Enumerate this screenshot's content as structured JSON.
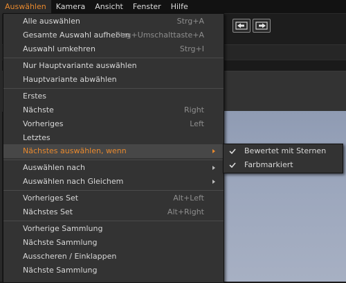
{
  "menubar": {
    "items": [
      "Auswählen",
      "Kamera",
      "Ansicht",
      "Fenster",
      "Hilfe"
    ]
  },
  "toolbar": {
    "icons": [
      "prev-image-icon",
      "next-image-icon"
    ]
  },
  "menu": {
    "items": [
      {
        "label": "Alle auswählen",
        "shortcut": "Strg+A"
      },
      {
        "label": "Gesamte Auswahl aufheben",
        "shortcut": "Strg+Umschalttaste+A"
      },
      {
        "label": "Auswahl umkehren",
        "shortcut": "Strg+I"
      },
      {
        "label": "Nur Hauptvariante auswählen",
        "shortcut": ""
      },
      {
        "label": "Hauptvariante abwählen",
        "shortcut": ""
      },
      {
        "label": "Erstes",
        "shortcut": ""
      },
      {
        "label": "Nächste",
        "shortcut": "Right"
      },
      {
        "label": "Vorheriges",
        "shortcut": "Left"
      },
      {
        "label": "Letztes",
        "shortcut": ""
      },
      {
        "label": "Nächstes auswählen, wenn",
        "shortcut": "",
        "submenu": true,
        "highlighted": true
      },
      {
        "label": "Auswählen nach",
        "shortcut": "",
        "submenu": true
      },
      {
        "label": "Auswählen nach Gleichem",
        "shortcut": "",
        "submenu": true
      },
      {
        "label": "Vorheriges Set",
        "shortcut": "Alt+Left"
      },
      {
        "label": "Nächstes Set",
        "shortcut": "Alt+Right"
      },
      {
        "label": "Vorherige Sammlung",
        "shortcut": ""
      },
      {
        "label": "Nächste Sammlung",
        "shortcut": ""
      },
      {
        "label": "Ausscheren / Einklappen",
        "shortcut": ""
      },
      {
        "label": "Nächste Sammlung",
        "shortcut": ""
      }
    ]
  },
  "submenu": {
    "items": [
      {
        "label": "Bewertet mit Sternen",
        "checked": true
      },
      {
        "label": "Farbmarkiert",
        "checked": true
      }
    ]
  },
  "colors": {
    "accent": "#e8892e",
    "menu_bg": "#333333",
    "highlight_bg": "#474747",
    "shortcut_text": "#8e8e8e"
  }
}
